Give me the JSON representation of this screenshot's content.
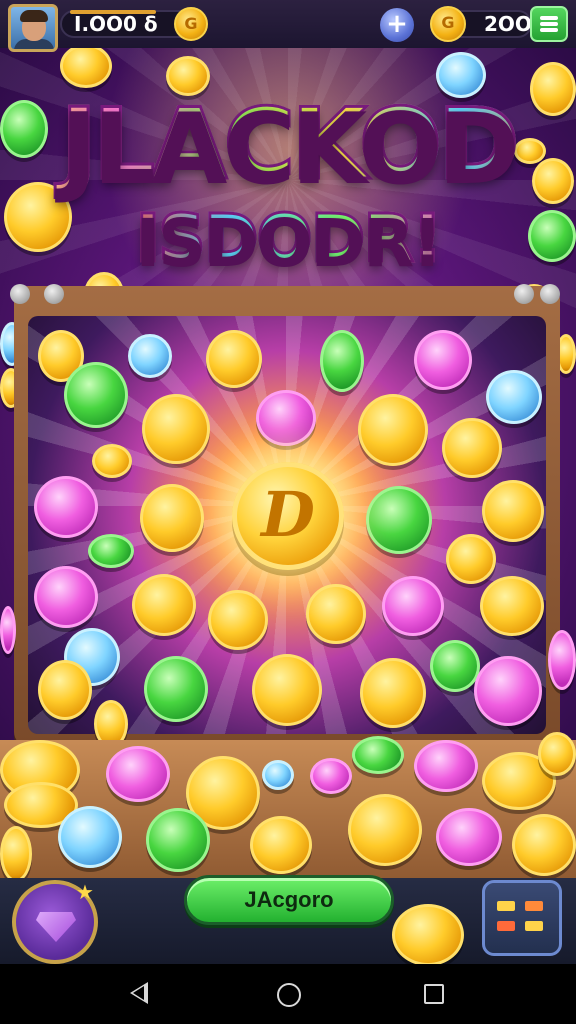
{
  "header": {
    "balance_left": "I.OO0 δ",
    "coin_glyph": "G",
    "balance_right": "2OO",
    "plus_glyph": "+"
  },
  "title": {
    "line1": "JLACKOD",
    "line2": "ISDODR!"
  },
  "board": {
    "center_coin_glyph": "D"
  },
  "controls": {
    "main_button_label": "JAcgoro"
  },
  "colors": {
    "accent_green": "#2bb534",
    "gold": "#ffcb2a",
    "board_wood": "#a46d44"
  },
  "icons": [
    "avatar",
    "coin-icon",
    "plus-icon",
    "menu-icon",
    "gem-icon",
    "grid-icon",
    "back-icon",
    "home-icon",
    "recents-icon"
  ]
}
